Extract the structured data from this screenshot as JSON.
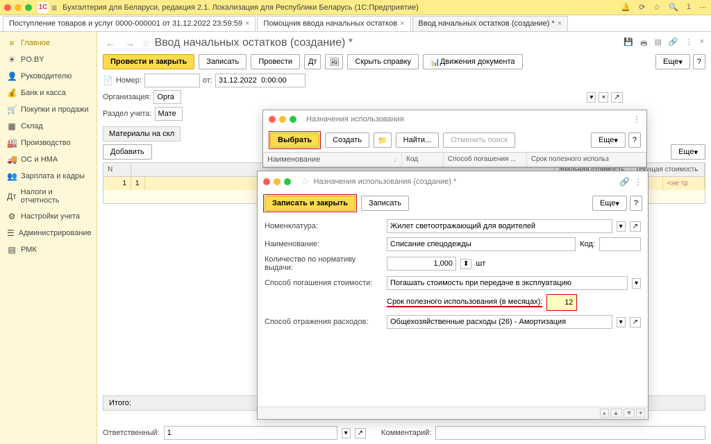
{
  "titlebar": {
    "app_title": "Бухгалтерия для Беларуси, редакция 2.1. Локализация для Республики Беларусь   (1С:Предприятие)"
  },
  "tabs": [
    "Поступление товаров и услуг 0000-000001 от 31.12.2022 23:59:59",
    "Помощник ввода начальных остатков",
    "Ввод начальных остатков (создание) *"
  ],
  "sidebar": [
    {
      "icon": "≡",
      "label": "Главное"
    },
    {
      "icon": "☀",
      "label": "PO.BY"
    },
    {
      "icon": "👤",
      "label": "Руководителю"
    },
    {
      "icon": "💰",
      "label": "Банк и касса"
    },
    {
      "icon": "🛒",
      "label": "Покупки и продажи"
    },
    {
      "icon": "▦",
      "label": "Склад"
    },
    {
      "icon": "🏭",
      "label": "Производство"
    },
    {
      "icon": "🚚",
      "label": "ОС и НМА"
    },
    {
      "icon": "👥",
      "label": "Зарплата и кадры"
    },
    {
      "icon": "Дт",
      "label": "Налоги и отчетность"
    },
    {
      "icon": "⚙",
      "label": "Настройки учета"
    },
    {
      "icon": "☰",
      "label": "Администрирование"
    },
    {
      "icon": "▤",
      "label": "РМК"
    }
  ],
  "page": {
    "title": "Ввод начальных остатков (создание) *",
    "btn_post_close": "Провести и закрыть",
    "btn_save": "Записать",
    "btn_post": "Провести",
    "btn_hide_help": "Скрыть справку",
    "btn_movements": "Движения документа",
    "btn_more": "Еще",
    "number_label": "Номер:",
    "from_label": "от:",
    "date_value": "31.12.2022  0:00:00",
    "org_label": "Организация:",
    "org_value": "Орга",
    "section_label": "Раздел учета:",
    "section_value": "Мате",
    "tab_materials": "Материалы на скл",
    "btn_add": "Добавить",
    "grid_headers": [
      "N",
      "1",
      "1"
    ],
    "col_initial": "ачальная стоимость",
    "col_current": "Текущая стоимость",
    "row_hint": "<не тр",
    "footer_total": "Итого:",
    "responsible_label": "Ответственный:",
    "responsible_value": "1",
    "comment_label": "Комментарий:"
  },
  "modal1": {
    "title": "Назначения использования",
    "btn_select": "Выбрать",
    "btn_create": "Создать",
    "btn_find": "Найти...",
    "btn_cancel_search": "Отменить поиск",
    "btn_more": "Еще",
    "col_name": "Наименование",
    "col_code": "Код",
    "col_method": "Способ погашения ...",
    "col_term": "Срок полезного использ"
  },
  "modal2": {
    "title": "Назначения использования (создание) *",
    "btn_save_close": "Записать и закрыть",
    "btn_save": "Записать",
    "btn_more": "Еще",
    "lbl_nomenclature": "Номенклатура:",
    "val_nomenclature": "Жилет светоотражающий для водителей",
    "lbl_name": "Наименование:",
    "val_name": "Списание спецодежды",
    "lbl_code": "Код:",
    "lbl_qty": "Количество по нормативу выдачи:",
    "val_qty": "1,000",
    "unit": "шт",
    "lbl_cost_method": "Способ погашения стоимости:",
    "val_cost_method": "Погашать стоимость при передаче в эксплуатацию",
    "lbl_term": "Срок полезного использования (в месяцах):",
    "val_term": "12",
    "lbl_expense": "Способ отражения расходов:",
    "val_expense": "Общехозяйственные расходы (26) - Амортизация"
  }
}
